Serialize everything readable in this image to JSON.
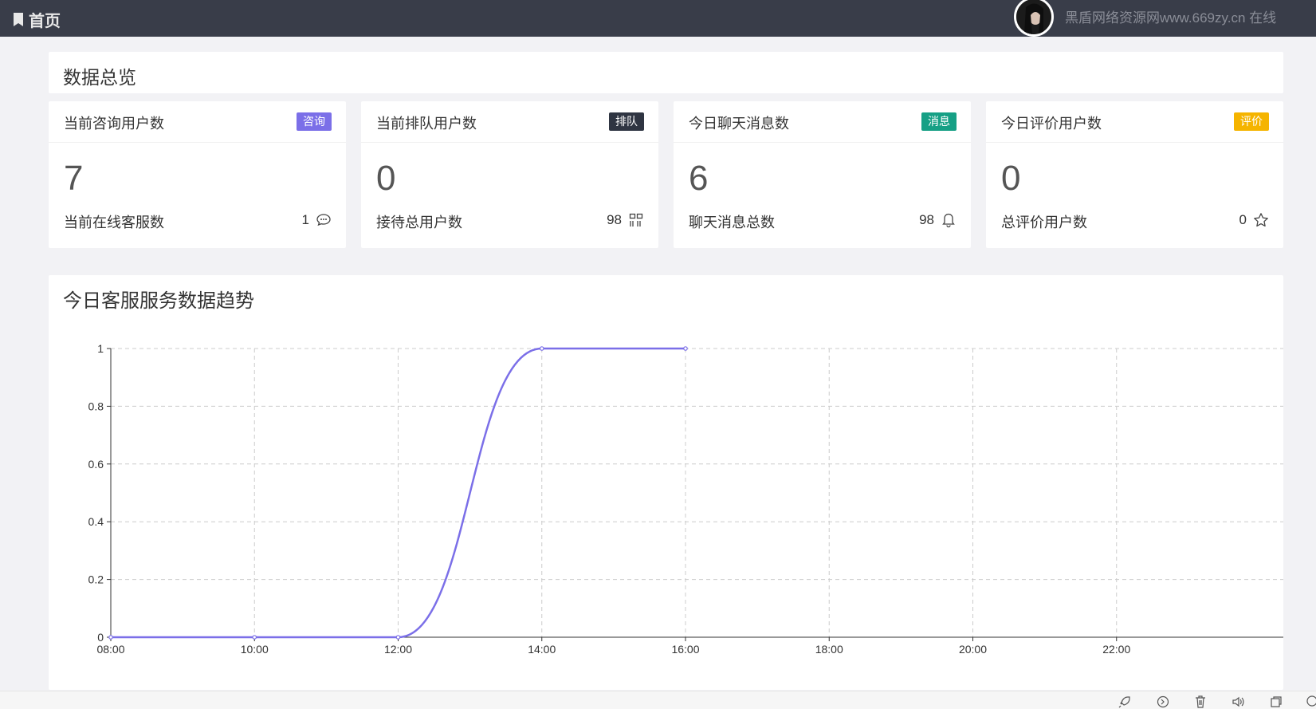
{
  "header": {
    "home_label": "首页",
    "user_text": "黑盾网络资源网www.669zy.cn 在线"
  },
  "overview": {
    "title": "数据总览"
  },
  "stats": [
    {
      "title": "当前咨询用户数",
      "badge": "咨询",
      "badge_color": "#7b6fe8",
      "value": "7",
      "sub_label": "当前在线客服数",
      "sub_value": "1",
      "icon": "chat-icon"
    },
    {
      "title": "当前排队用户数",
      "badge": "排队",
      "badge_color": "#2f3542",
      "value": "0",
      "sub_label": "接待总用户数",
      "sub_value": "98",
      "icon": "grid-icon"
    },
    {
      "title": "今日聊天消息数",
      "badge": "消息",
      "badge_color": "#16a085",
      "value": "6",
      "sub_label": "聊天消息总数",
      "sub_value": "98",
      "icon": "bell-icon"
    },
    {
      "title": "今日评价用户数",
      "badge": "评价",
      "badge_color": "#f5b400",
      "value": "0",
      "sub_label": "总评价用户数",
      "sub_value": "0",
      "icon": "star-icon"
    }
  ],
  "trend": {
    "title": "今日客服服务数据趋势"
  },
  "chart_data": {
    "type": "line",
    "title": "",
    "x": [
      "08:00",
      "10:00",
      "12:00",
      "14:00",
      "16:00"
    ],
    "x_ticks": [
      "08:00",
      "10:00",
      "12:00",
      "14:00",
      "16:00",
      "18:00",
      "20:00",
      "22:00"
    ],
    "y_ticks": [
      "0",
      "0.2",
      "0.4",
      "0.6",
      "0.8",
      "1"
    ],
    "ylim": [
      0,
      1
    ],
    "series": [
      {
        "values": [
          0,
          0,
          0,
          1,
          1
        ],
        "color": "#7b6fe8"
      }
    ],
    "grid": true,
    "smooth": true
  },
  "colors": {
    "topbar": "#393d49",
    "line": "#7b6fe8"
  }
}
